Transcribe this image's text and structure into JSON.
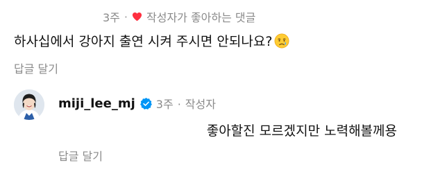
{
  "top_comment": {
    "time": "3주",
    "separator": "·",
    "liked_by_author": "작성자가 좋아하는 댓글",
    "text": "하사십에서 강아지 출연 시켜 주시면 안되나요?",
    "emoji_icon": "crying-face-icon",
    "reply_label": "답글 달기"
  },
  "reply": {
    "username": "miji_lee_mj",
    "verified_icon": "verified-badge-icon",
    "time": "3주",
    "separator": "·",
    "role": "작성자",
    "text": "좋아할진 모르겠지만 노력해볼께용",
    "reply_label": "답글 달기"
  },
  "colors": {
    "heart": "#ff3040",
    "verified": "#0095f6",
    "muted_text": "#8a8a8a"
  }
}
